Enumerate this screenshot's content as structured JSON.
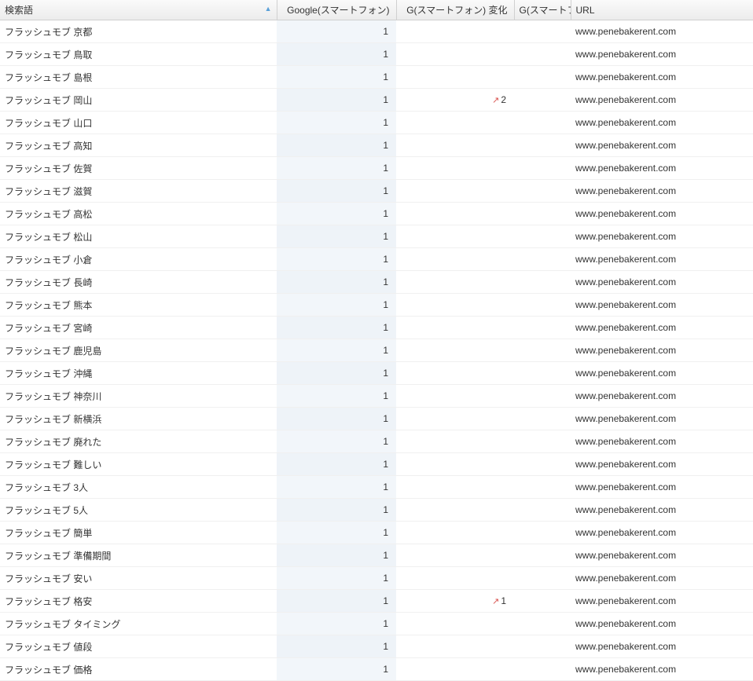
{
  "columns": {
    "keyword": "検索語",
    "google": "Google(スマートフォン)",
    "change": "G(スマートフォン) 変化",
    "trunc": "G(スマートフ..",
    "url": "URL"
  },
  "sort": {
    "column": "keyword",
    "direction": "asc",
    "indicator": "▲"
  },
  "rows": [
    {
      "keyword": "フラッシュモブ 京都",
      "google": "1",
      "change": "",
      "url": "www.penebakerent.com"
    },
    {
      "keyword": "フラッシュモブ 鳥取",
      "google": "1",
      "change": "",
      "url": "www.penebakerent.com"
    },
    {
      "keyword": "フラッシュモブ 島根",
      "google": "1",
      "change": "",
      "url": "www.penebakerent.com"
    },
    {
      "keyword": "フラッシュモブ 岡山",
      "google": "1",
      "change": "2",
      "change_dir": "up",
      "url": "www.penebakerent.com"
    },
    {
      "keyword": "フラッシュモブ 山口",
      "google": "1",
      "change": "",
      "url": "www.penebakerent.com"
    },
    {
      "keyword": "フラッシュモブ 高知",
      "google": "1",
      "change": "",
      "url": "www.penebakerent.com"
    },
    {
      "keyword": "フラッシュモブ 佐賀",
      "google": "1",
      "change": "",
      "url": "www.penebakerent.com"
    },
    {
      "keyword": "フラッシュモブ 滋賀",
      "google": "1",
      "change": "",
      "url": "www.penebakerent.com"
    },
    {
      "keyword": "フラッシュモブ 高松",
      "google": "1",
      "change": "",
      "url": "www.penebakerent.com"
    },
    {
      "keyword": "フラッシュモブ 松山",
      "google": "1",
      "change": "",
      "url": "www.penebakerent.com"
    },
    {
      "keyword": "フラッシュモブ 小倉",
      "google": "1",
      "change": "",
      "url": "www.penebakerent.com"
    },
    {
      "keyword": "フラッシュモブ 長崎",
      "google": "1",
      "change": "",
      "url": "www.penebakerent.com"
    },
    {
      "keyword": "フラッシュモブ 熊本",
      "google": "1",
      "change": "",
      "url": "www.penebakerent.com"
    },
    {
      "keyword": "フラッシュモブ 宮崎",
      "google": "1",
      "change": "",
      "url": "www.penebakerent.com"
    },
    {
      "keyword": "フラッシュモブ 鹿児島",
      "google": "1",
      "change": "",
      "url": "www.penebakerent.com"
    },
    {
      "keyword": "フラッシュモブ 沖縄",
      "google": "1",
      "change": "",
      "url": "www.penebakerent.com"
    },
    {
      "keyword": "フラッシュモブ 神奈川",
      "google": "1",
      "change": "",
      "url": "www.penebakerent.com"
    },
    {
      "keyword": "フラッシュモブ 新横浜",
      "google": "1",
      "change": "",
      "url": "www.penebakerent.com"
    },
    {
      "keyword": "フラッシュモブ 廃れた",
      "google": "1",
      "change": "",
      "url": "www.penebakerent.com"
    },
    {
      "keyword": "フラッシュモブ 難しい",
      "google": "1",
      "change": "",
      "url": "www.penebakerent.com"
    },
    {
      "keyword": "フラッシュモブ 3人",
      "google": "1",
      "change": "",
      "url": "www.penebakerent.com"
    },
    {
      "keyword": "フラッシュモブ 5人",
      "google": "1",
      "change": "",
      "url": "www.penebakerent.com"
    },
    {
      "keyword": "フラッシュモブ 簡単",
      "google": "1",
      "change": "",
      "url": "www.penebakerent.com"
    },
    {
      "keyword": "フラッシュモブ 準備期間",
      "google": "1",
      "change": "",
      "url": "www.penebakerent.com"
    },
    {
      "keyword": "フラッシュモブ 安い",
      "google": "1",
      "change": "",
      "url": "www.penebakerent.com"
    },
    {
      "keyword": "フラッシュモブ 格安",
      "google": "1",
      "change": "1",
      "change_dir": "up",
      "url": "www.penebakerent.com"
    },
    {
      "keyword": "フラッシュモブ タイミング",
      "google": "1",
      "change": "",
      "url": "www.penebakerent.com"
    },
    {
      "keyword": "フラッシュモブ 値段",
      "google": "1",
      "change": "",
      "url": "www.penebakerent.com"
    },
    {
      "keyword": "フラッシュモブ 価格",
      "google": "1",
      "change": "",
      "url": "www.penebakerent.com"
    }
  ]
}
